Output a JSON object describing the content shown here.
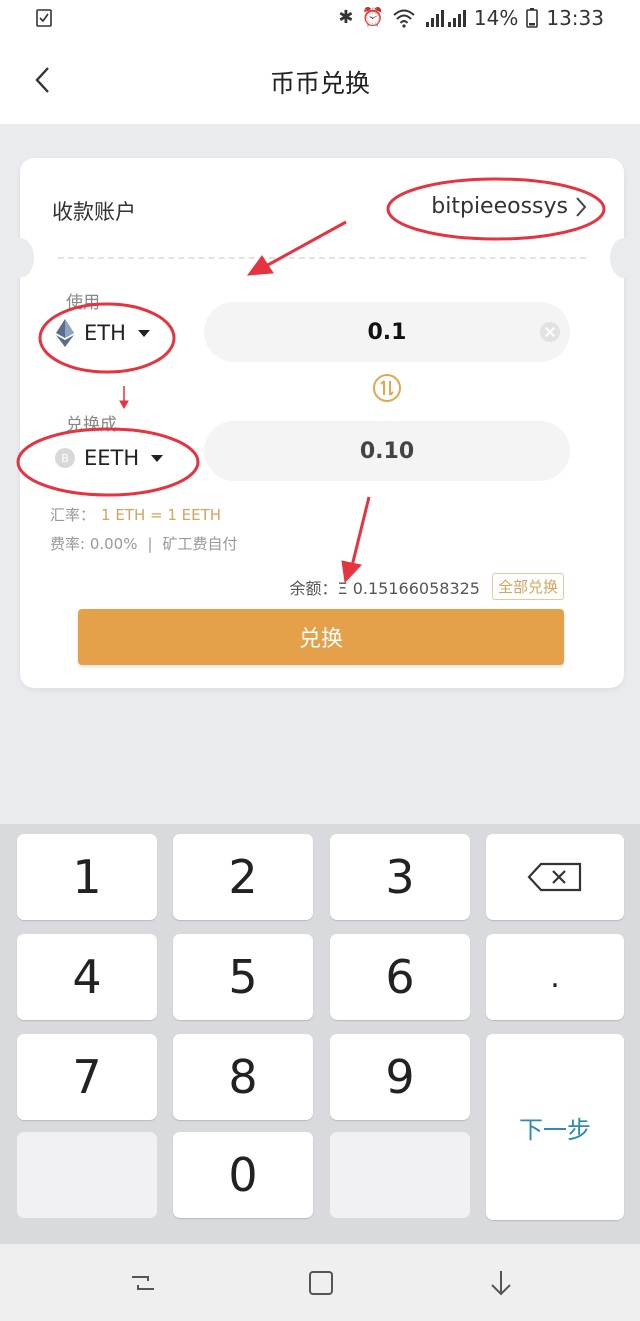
{
  "status_bar": {
    "battery": "14%",
    "time": "13:33"
  },
  "header": {
    "title": "币币兑换"
  },
  "card": {
    "receive_label": "收款账户",
    "receive_account": "bitpieeossys",
    "use_label": "使用",
    "from_coin": "ETH",
    "from_amount": "0.1",
    "convert_label": "兑换成",
    "to_coin": "EETH",
    "to_amount": "0.10",
    "rate_label": "汇率：",
    "rate_value": "1 ETH = 1 EETH",
    "fee_label": "费率: 0.00%",
    "fee_separator": "|",
    "miner_fee": "矿工费自付",
    "balance_label": "余额：",
    "balance_symbol": "Ξ",
    "balance_value": "0.15166058325",
    "convert_all": "全部兑换",
    "exchange_button": "兑换"
  },
  "keyboard": {
    "keys": [
      "1",
      "2",
      "3",
      "4",
      "5",
      "6",
      "7",
      "8",
      "9",
      "0"
    ],
    "dot": ".",
    "next": "下一步"
  },
  "icons": {
    "back": "chevron-left-icon",
    "account_chevron": "chevron-right-icon",
    "eth": "ethereum-icon",
    "eeth": "eeth-coin-icon",
    "swap": "swap-arrows-icon",
    "backspace": "backspace-icon"
  },
  "colors": {
    "accent": "#e5a04a",
    "gold_text": "#d6a35c",
    "next_key": "#2f89b7",
    "annotation": "#e53340"
  }
}
